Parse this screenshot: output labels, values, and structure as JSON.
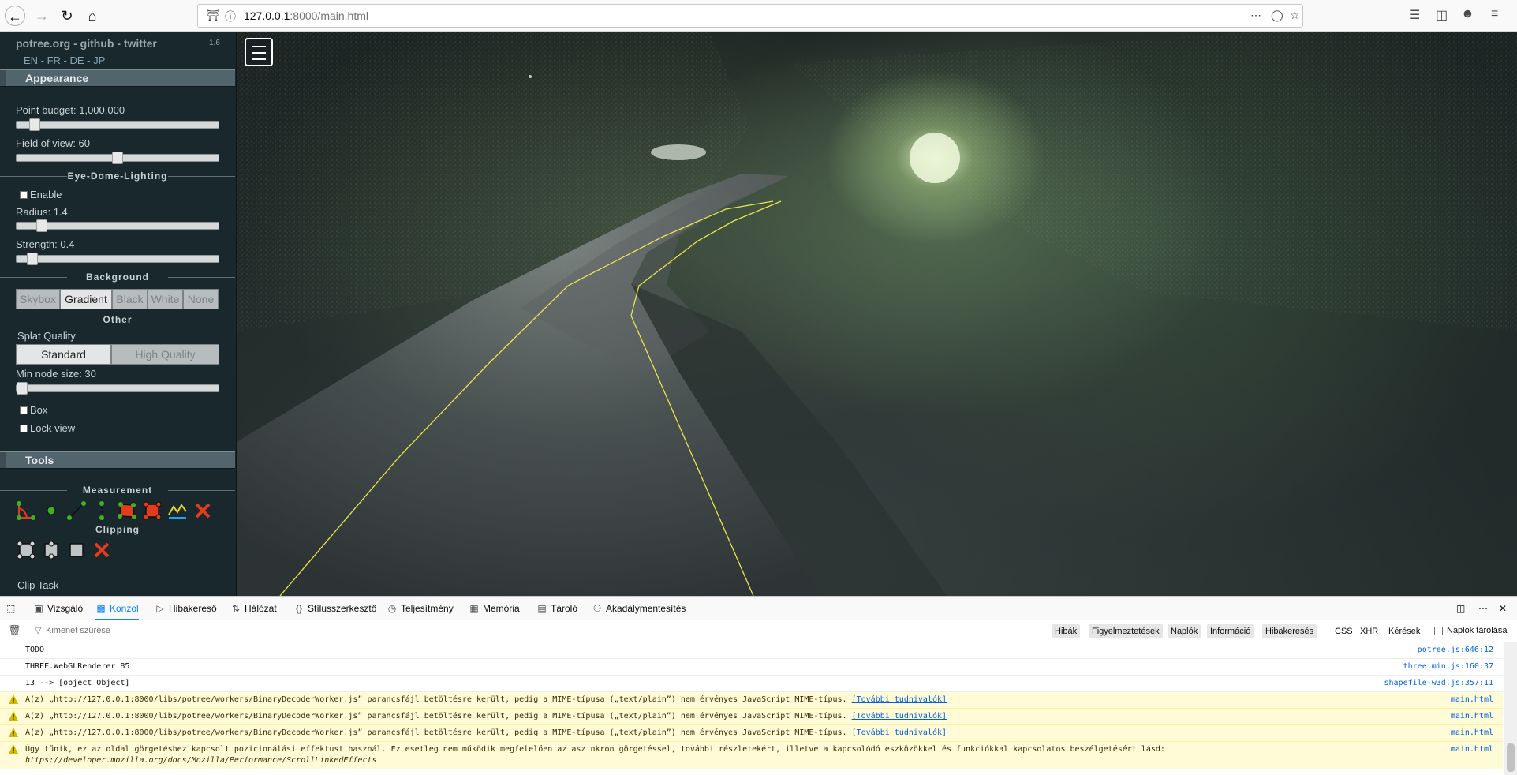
{
  "browser": {
    "url_host": "127.0.0.1",
    "url_rest": ":8000/main.html"
  },
  "sidebar": {
    "links": "potree.org - github - twitter",
    "version": "1.6",
    "languages": "EN - FR - DE - JP",
    "appearance_header": "Appearance",
    "point_budget_label": "Point budget: 1,000,000",
    "point_budget_value": 0.1,
    "fov_label": "Field of view: 60",
    "fov_value": 0.5,
    "edl_section": "Eye-Dome-Lighting",
    "edl_enable_label": "Enable",
    "radius_label": "Radius: 1.4",
    "strength_label": "Strength: 0.4",
    "background_section": "Background",
    "background_options": [
      "Skybox",
      "Gradient",
      "Black",
      "White",
      "None"
    ],
    "background_selected": "Gradient",
    "other_section": "Other",
    "splat_quality_label": "Splat Quality",
    "splat_options": [
      "Standard",
      "High Quality"
    ],
    "splat_selected": "Standard",
    "min_node_label": "Min node size: 30",
    "box_label": "Box",
    "lock_view_label": "Lock view",
    "tools_header": "Tools",
    "measurement_section": "Measurement",
    "clipping_section": "Clipping",
    "clip_task_label": "Clip Task"
  },
  "devtools": {
    "tabs": [
      "Vizsgáló",
      "Konzol",
      "Hibakereső",
      "Hálózat",
      "Stílusszerkesztő",
      "Teljesítmény",
      "Memória",
      "Tároló",
      "Akadálymentesítés"
    ],
    "active_tab": "Konzol",
    "filter_placeholder": "Kimenet szűrése",
    "filter_levels": [
      "Hibák",
      "Figyelmeztetések",
      "Naplók",
      "Információ",
      "Hibakeresés"
    ],
    "filter_types": [
      "CSS",
      "XHR",
      "Kérések"
    ],
    "persist_logs_label": "Naplók tárolása",
    "messages": [
      {
        "text": "TODO",
        "source": "potree.js:646:12",
        "level": "log"
      },
      {
        "text": "THREE.WebGLRenderer 85",
        "source": "three.min.js:160:37",
        "level": "log"
      },
      {
        "text": "13 --> [object Object]",
        "source": "shapefile-w3d.js:357:11",
        "level": "log"
      },
      {
        "text": "A(z) „http://127.0.0.1:8000/libs/potree/workers/BinaryDecoderWorker.js” parancsfájl betöltésre került, pedig a MIME-típusa („text/plain”) nem érvényes JavaScript MIME-típus.",
        "more": "[További tudnivalók]",
        "source": "main.html",
        "level": "warn"
      },
      {
        "text": "A(z) „http://127.0.0.1:8000/libs/potree/workers/BinaryDecoderWorker.js” parancsfájl betöltésre került, pedig a MIME-típusa („text/plain”) nem érvényes JavaScript MIME-típus.",
        "more": "[További tudnivalók]",
        "source": "main.html",
        "level": "warn"
      },
      {
        "text": "A(z) „http://127.0.0.1:8000/libs/potree/workers/BinaryDecoderWorker.js” parancsfájl betöltésre került, pedig a MIME-típusa („text/plain”) nem érvényes JavaScript MIME-típus.",
        "more": "[További tudnivalók]",
        "source": "main.html",
        "level": "warn"
      },
      {
        "text": "Úgy tűnik, ez az oldal görgetéshez kapcsolt pozicionálási effektust használ. Ez esetleg nem működik megfelelően az aszinkron görgetéssel, további részletekért, illetve a kapcsolódó eszközökkel és funkciókkal kapcsolatos beszélgetésért lásd:",
        "link": "https://developer.mozilla.org/docs/Mozilla/Performance/ScrollLinkedEffects",
        "source": "main.html",
        "level": "warn"
      }
    ]
  },
  "colors": {
    "sidebar_bg": "#19282c",
    "header_bg": "#52646c",
    "warn_bg": "#fffbd6",
    "accent": "#0a84ff",
    "path_line": "#e6e64a"
  }
}
